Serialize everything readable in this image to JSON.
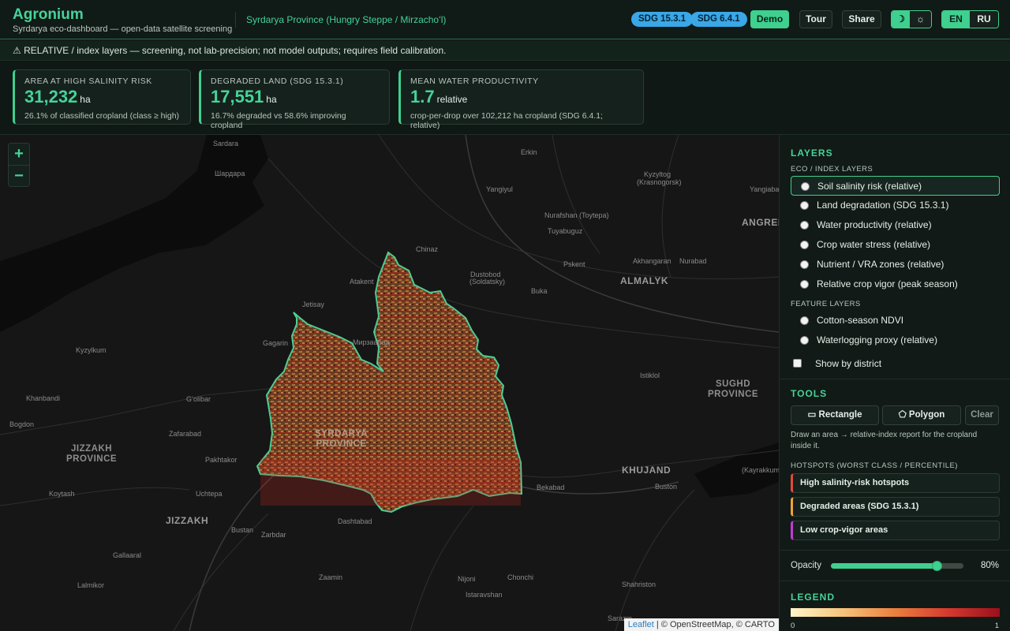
{
  "header": {
    "brand": "Agronium",
    "subtitle": "Syrdarya eco-dashboard — open-data satellite screening",
    "region": "Syrdarya Province (Hungry Steppe / Mirzachoʻl)",
    "badges": [
      "SDG 15.3.1",
      "SDG 6.4.1"
    ],
    "demo_label": "Demo",
    "tour_label": "Tour",
    "share_label": "Share",
    "theme_dark_icon": "☽",
    "theme_light_icon": "☼",
    "lang_en": "EN",
    "lang_ru": "RU"
  },
  "warning": "⚠ RELATIVE / index layers — screening, not lab-precision; not model outputs; requires field calibration.",
  "kpis": [
    {
      "label": "AREA AT HIGH SALINITY RISK",
      "value": "31,232",
      "unit": "ha",
      "note": "26.1% of classified cropland (class ≥ high)"
    },
    {
      "label": "DEGRADED LAND (SDG 15.3.1)",
      "value": "17,551",
      "unit": "ha",
      "note": "16.7% degraded vs 58.6% improving cropland"
    },
    {
      "label": "MEAN WATER PRODUCTIVITY",
      "value": "1.7",
      "unit": "relative",
      "note": "crop-per-drop over 102,212 ha cropland (SDG 6.4.1; relative)"
    }
  ],
  "map": {
    "zoom_in": "+",
    "zoom_out": "−",
    "attribution_leaflet": "Leaflet",
    "attribution_rest": " | © OpenStreetMap, © CARTO",
    "labels": {
      "sardara": "Sardara",
      "shardara_cyr": "Шардара",
      "erkin": "Erkin",
      "kyzyltog": "Kyzyltog",
      "krasnogorsk": "(Krasnogorsk)",
      "yangiyul": "Yangiyul",
      "yangiabad": "Yangiaba",
      "nurafshan": "Nurafshan (Toytepa)",
      "tuyabuguz": "Tuyabuguz",
      "angren": "ANGREN",
      "chinaz": "Chinaz",
      "pskent": "Pskent",
      "akhangaran": "Akhangaran",
      "nurabad": "Nurabad",
      "dustobod": "Dustobod",
      "soldatsky": "(Soldatsky)",
      "almalyk": "ALMALYK",
      "atakent": "Atakent",
      "buka": "Buka",
      "jetisay": "Jetisay",
      "kyzylkum": "Kyzylkum",
      "gagarin": "Gagarin",
      "mirzaabad_cyr": "Мирзаабад",
      "istiklol": "Istiklol",
      "sughd": "SUGHD\nPROVINCE",
      "khanbandi": "Khanbandi",
      "goolibar": "Gʻolibar",
      "bogdon": "Bogdon",
      "jizzakh_prov": "JIZZAKH\nPROVINCE",
      "zafarabad": "Zafarabad",
      "syrdarya_prov": "SYRDARYA\nPROVINCE",
      "pakhtakor": "Pakhtakor",
      "khujand": "KHUJAND",
      "buston_e": "Buston",
      "kayrakkum": "(Kayrakkum)",
      "koytash": "Koytash",
      "uchtepa": "Uchtepa",
      "bekabad": "Bekabad",
      "jizzakh": "JIZZAKH",
      "dashtabad": "Dashtabad",
      "buston_w": "Bustan",
      "zarbdar": "Zarbdar",
      "gallaaral": "Gallaaral",
      "lalmikor": "Lalmikor",
      "zaamin": "Zaamin",
      "nijoni": "Nijoni",
      "chonchi": "Chonchi",
      "istaravshan": "Istaravshan",
      "shahriston": "Shahriston",
      "sarazm": "Sarazm"
    }
  },
  "sidebar": {
    "layers_title": "LAYERS",
    "eco_title": "ECO / INDEX LAYERS",
    "eco_layers": [
      "Soil salinity risk (relative)",
      "Land degradation (SDG 15.3.1)",
      "Water productivity (relative)",
      "Crop water stress (relative)",
      "Nutrient / VRA zones (relative)",
      "Relative crop vigor (peak season)"
    ],
    "feature_title": "FEATURE LAYERS",
    "feature_layers": [
      "Cotton-season NDVI",
      "Waterlogging proxy (relative)"
    ],
    "by_district": "Show by district",
    "tools_title": "TOOLS",
    "tool_rect": "▭ Rectangle",
    "tool_poly": "⬠ Polygon",
    "tool_clear": "Clear",
    "tools_note": "Draw an area → relative-index report for the cropland inside it.",
    "hotspots_title": "HOTSPOTS (WORST CLASS / PERCENTILE)",
    "hotspots": [
      {
        "label": "High salinity-risk hotspots",
        "color": "#e04b3a"
      },
      {
        "label": "Degraded areas (SDG 15.3.1)",
        "color": "#f0a23a"
      },
      {
        "label": "Low crop-vigor areas",
        "color": "#c43ad6"
      }
    ],
    "opacity_label": "Opacity",
    "opacity_value": 80,
    "opacity_text": "80%",
    "legend_title": "LEGEND",
    "legend_min": "0",
    "legend_max": "1"
  },
  "colors": {
    "accent": "#3fcf8e",
    "badge": "#3aa7e6"
  }
}
